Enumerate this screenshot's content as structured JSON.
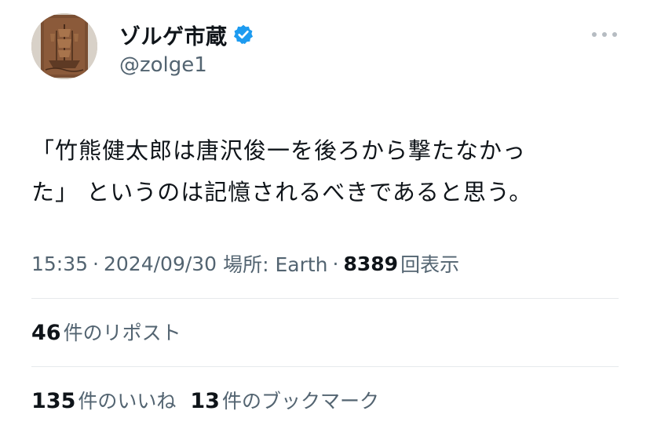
{
  "tweet": {
    "author": {
      "display_name": "ゾルゲ市蔵",
      "handle": "@zolge1",
      "verified": true,
      "avatar": "sailing-ship-relief-avatar"
    },
    "text_lines": [
      "「竹熊健太郎は唐沢俊一を後ろから撃たなかっ",
      "た」 というのは記憶されるべきであると思う。"
    ],
    "meta": {
      "time": "15:35",
      "separator": "·",
      "date": "2024/09/30",
      "location": "場所: Earth",
      "views_count": "8389",
      "views_label": "回表示"
    },
    "stats": {
      "reposts": {
        "count": "46",
        "label": "件のリポスト"
      },
      "likes": {
        "count": "135",
        "label": "件のいいね"
      },
      "bookmarks": {
        "count": "13",
        "label": "件のブックマーク"
      }
    }
  },
  "colors": {
    "text_primary": "#0f1419",
    "text_secondary": "#536471",
    "verified_blue": "#1d9bf0",
    "divider": "#e6e9ec"
  }
}
